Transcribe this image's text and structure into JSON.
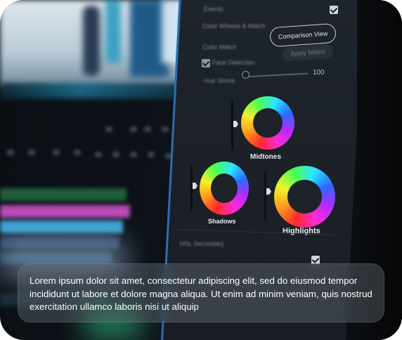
{
  "panel": {
    "compare_button": "Comparison View",
    "apply_button": "Apply Match",
    "rows": [
      "Events",
      "Color Wheels & Match",
      "Color Match",
      "Face Detection",
      "Hue Shrink",
      "HSL Secondary"
    ],
    "slider_value": "100"
  },
  "wheels": {
    "midtones": "Midtones",
    "shadows": "Shadows",
    "highlights": "Highlights"
  },
  "caption": {
    "text": "Lorem ipsum dolor sit amet, consectetur adipiscing elit, sed do eiusmod tempor incididunt ut labore et dolore magna aliqua. Ut enim ad minim veniam, quis nostrud exercitation ullamco laboris nisi ut aliquip"
  },
  "colors": {
    "accent_blue": "#2a6fb0",
    "caption_bg": "rgba(110,118,128,0.38)"
  }
}
